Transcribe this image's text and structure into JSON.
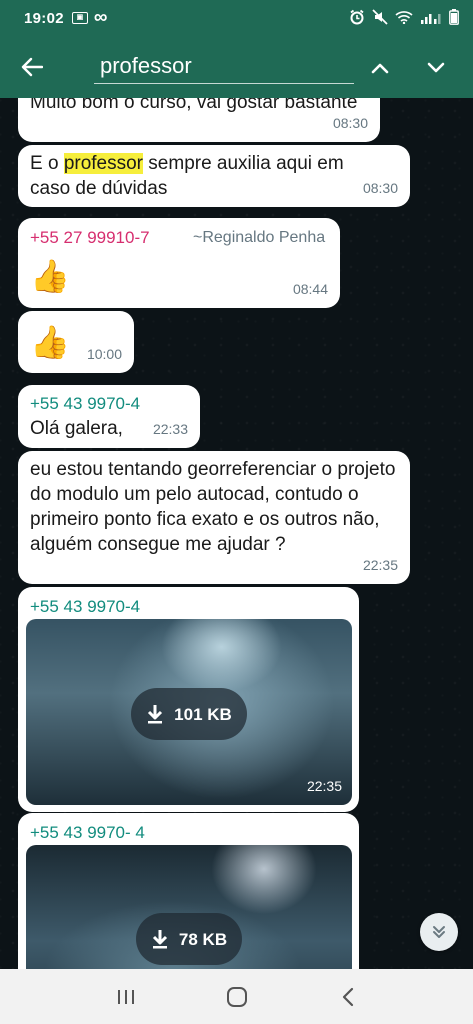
{
  "status_bar": {
    "time": "19:02",
    "left_icons": [
      "gallery-icon",
      "infinity-icon"
    ],
    "right_icons": [
      "alarm-icon",
      "mute-icon",
      "wifi-icon",
      "signal-icon",
      "battery-icon"
    ]
  },
  "search": {
    "query": "professor",
    "back_icon": "arrow-left-icon",
    "prev_icon": "chevron-up-icon",
    "next_icon": "chevron-down-icon"
  },
  "messages": [
    {
      "text": "Muito bom o curso, vai gostar bastante",
      "time": "08:30"
    },
    {
      "text_before": "E o ",
      "highlight": "professor",
      "text_after": " sempre auxilia aqui em caso de dúvidas",
      "time": "08:30"
    },
    {
      "sender_number": "+55 27 99910-7",
      "sender_name": "~Reginaldo Penha",
      "content": "👍",
      "time": "08:44"
    },
    {
      "content": "👍",
      "time": "10:00"
    },
    {
      "sender_number": "+55 43 9970-4",
      "text": "Olá galera,",
      "time": "22:33"
    },
    {
      "text": "eu estou tentando georreferenciar o projeto do modulo um pelo autocad, contudo o primeiro ponto fica exato e os outros não, alguém consegue me ajudar ?",
      "time": "22:35"
    },
    {
      "sender_number": "+55 43 9970-4",
      "media_size": "101 KB",
      "time": "22:35"
    },
    {
      "sender_number": "+55 43 9970-   4",
      "media_size": "78 KB"
    }
  ],
  "scroll_button_icon": "double-chevron-down-icon",
  "nav": [
    "recent-apps-icon",
    "home-icon",
    "back-icon"
  ],
  "colors": {
    "header": "#1f6a55",
    "bubble": "#ffffff",
    "highlight": "#f6ee3c",
    "sender_green": "#128c7e",
    "sender_pink": "#d62e6f"
  }
}
